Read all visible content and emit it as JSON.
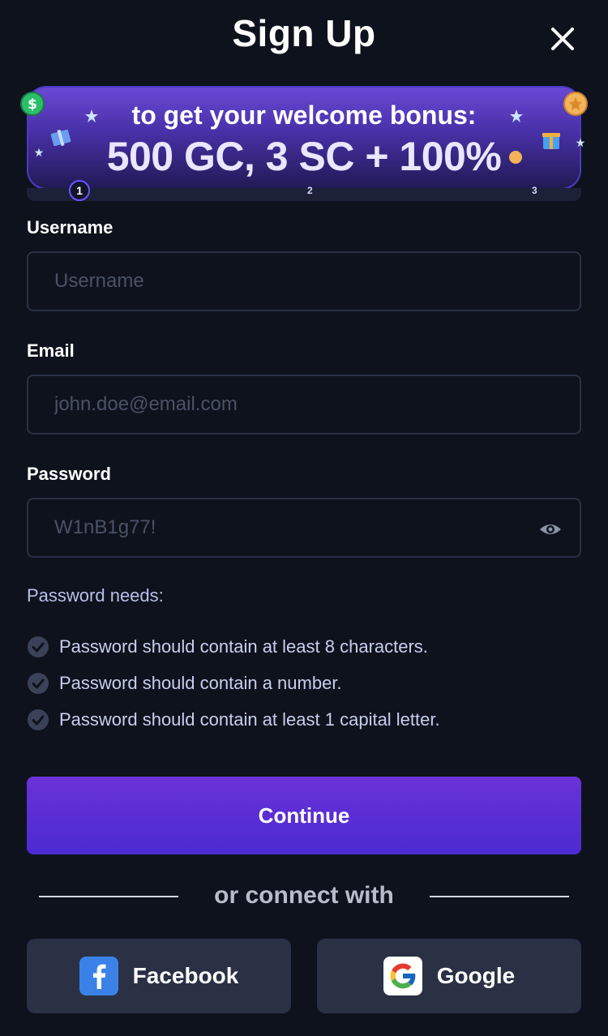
{
  "header": {
    "title": "Sign Up"
  },
  "banner": {
    "line1": "to get your welcome bonus:",
    "line2": "500 GC, 3 SC + 100%",
    "steps": [
      "1",
      "2",
      "3"
    ],
    "active_step": 1
  },
  "form": {
    "username": {
      "label": "Username",
      "placeholder": "Username"
    },
    "email": {
      "label": "Email",
      "placeholder": "john.doe@email.com"
    },
    "password": {
      "label": "Password",
      "placeholder": "W1nB1g77!"
    }
  },
  "password_needs": {
    "heading": "Password needs:",
    "rules": [
      "Password should contain at least 8 characters.",
      "Password should contain a number.",
      "Password should contain at least 1 capital letter."
    ]
  },
  "continue_label": "Continue",
  "divider_text": "or connect with",
  "social": {
    "facebook_label": "Facebook",
    "google_label": "Google"
  },
  "colors": {
    "background": "#0e121c",
    "accent": "#5a2ed4",
    "banner": "#4730a6",
    "social_button": "#2a3145"
  }
}
